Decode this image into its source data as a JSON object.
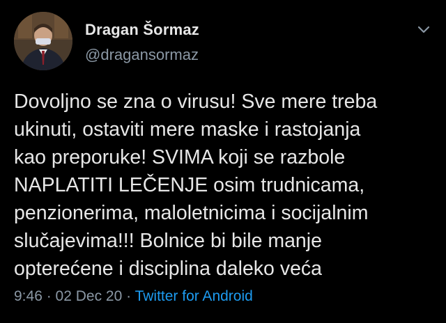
{
  "author": {
    "display_name": "Dragan Šormaz",
    "handle": "@dragansormaz"
  },
  "menu": {
    "icon": "chevron-down-icon"
  },
  "tweet": {
    "text": "Dovoljno se zna o virusu! Sve mere treba\nukinuti,  ostaviti mere maske i rastojanja\nkao preporuke! SVIMA koji se razbole\nNAPLATITI LEČENJE osim trudnicama,\npenzionerima, maloletnicima i socijalnim\nslučajevima!!! Bolnice bi bile manje\nopterećene i disciplina daleko veća"
  },
  "meta": {
    "time": "9:46",
    "separator1": " · ",
    "date": "02 Dec 20",
    "separator2": " · ",
    "source": "Twitter for Android"
  },
  "colors": {
    "background": "#000000",
    "text": "#e7e7e7",
    "secondary": "#8b98a5",
    "link": "#1d9bf0"
  }
}
